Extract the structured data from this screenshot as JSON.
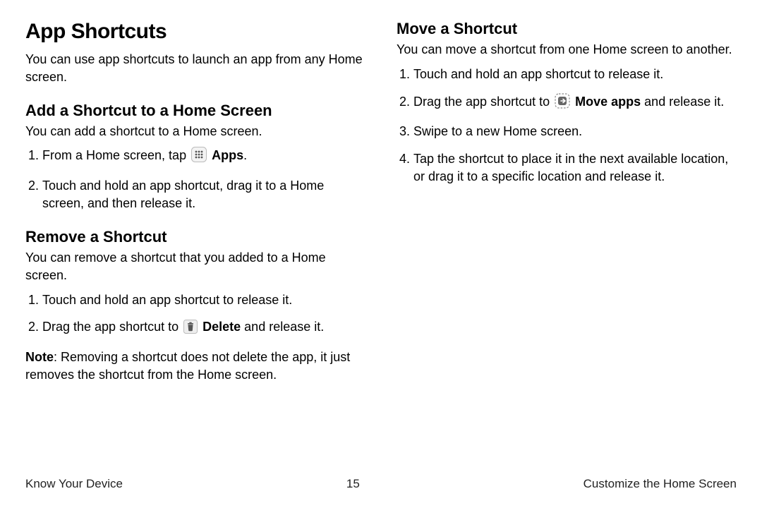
{
  "h1": "App Shortcuts",
  "intro": "You can use app shortcuts to launch an app from any Home screen.",
  "add": {
    "heading": "Add a Shortcut to a Home Screen",
    "intro": "You can add a shortcut to a Home screen.",
    "step1_pre": "From a Home screen, tap ",
    "step1_bold": "Apps",
    "step1_post": ".",
    "step2": "Touch and hold an app shortcut, drag it to a Home screen, and then release it."
  },
  "remove": {
    "heading": "Remove a Shortcut",
    "intro": "You can remove a shortcut that you added to a Home screen.",
    "step1": "Touch and hold an app shortcut to release it.",
    "step2_pre": "Drag the app shortcut to ",
    "step2_bold": "Delete",
    "step2_post": " and release it.",
    "note_label": "Note",
    "note_body": ": Removing a shortcut does not delete the app, it just removes the shortcut from the Home screen."
  },
  "move": {
    "heading": "Move a Shortcut",
    "intro": "You can move a shortcut from one Home screen to another.",
    "step1": "Touch and hold an app shortcut to release it.",
    "step2_pre": "Drag the app shortcut to ",
    "step2_bold": "Move apps",
    "step2_post": " and release it.",
    "step3": "Swipe to a new Home screen.",
    "step4": "Tap the shortcut to place it in the next available location, or drag it to a specific location and release it."
  },
  "footer": {
    "left": "Know Your Device",
    "center": "15",
    "right": "Customize the Home Screen"
  }
}
